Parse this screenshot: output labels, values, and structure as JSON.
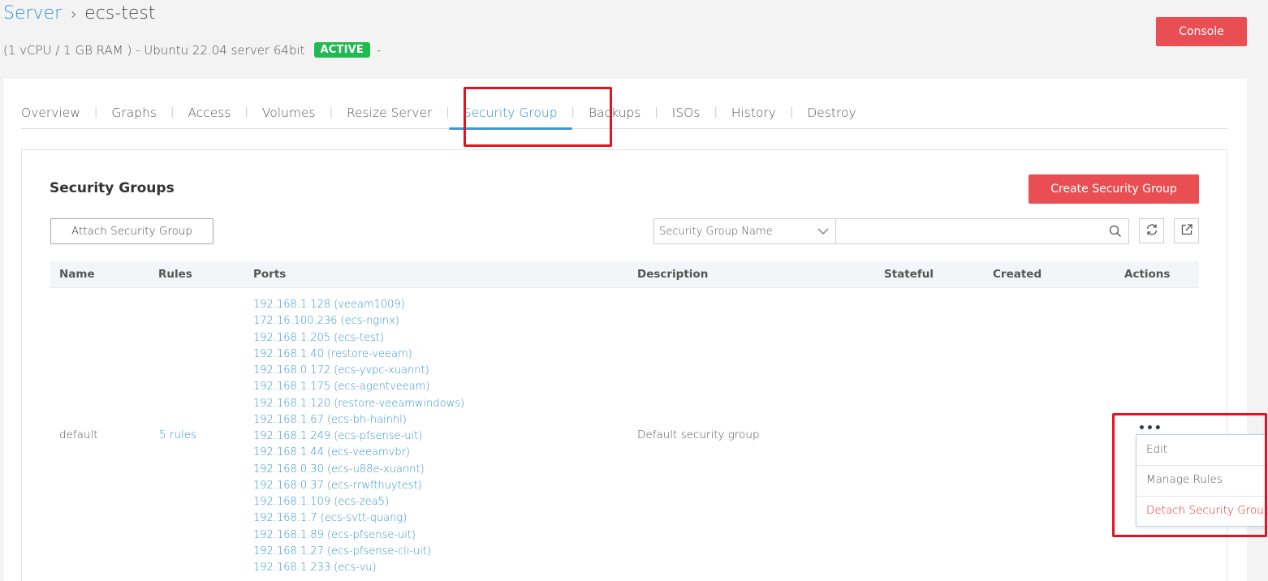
{
  "breadcrumb": {
    "root": "Server",
    "separator": "›",
    "current": "ecs-test"
  },
  "server_info": {
    "spec": "(1 vCPU / 1 GB RAM ) - Ubuntu 22.04 server 64bit",
    "status": "ACTIVE",
    "suffix": "-"
  },
  "console_label": "Console",
  "tabs": [
    {
      "label": "Overview"
    },
    {
      "label": "Graphs"
    },
    {
      "label": "Access"
    },
    {
      "label": "Volumes"
    },
    {
      "label": "Resize Server"
    },
    {
      "label": "Security Group"
    },
    {
      "label": "Backups"
    },
    {
      "label": "ISOs"
    },
    {
      "label": "History"
    },
    {
      "label": "Destroy"
    }
  ],
  "tab_separator": "|",
  "active_tab": "Security Group",
  "section": {
    "title": "Security Groups",
    "create_label": "Create Security Group",
    "attach_label": "Attach Security Group"
  },
  "filter": {
    "selected": "Security Group Name",
    "search_value": ""
  },
  "table": {
    "headers": {
      "name": "Name",
      "rules": "Rules",
      "ports": "Ports",
      "description": "Description",
      "stateful": "Stateful",
      "created": "Created",
      "actions": "Actions"
    },
    "row": {
      "name": "default",
      "rules": "5 rules",
      "description": "Default security group",
      "stateful": "",
      "created": "",
      "actions_icon": "•••",
      "ports": [
        "192.168.1.128 (veeam1009)",
        "172.16.100.236 (ecs-nginx)",
        "192.168.1.205 (ecs-test)",
        "192.168.1.40 (restore-veeam)",
        "192.168.0.172 (ecs-yvpc-xuannt)",
        "192.168.1.175 (ecs-agentveeam)",
        "192.168.1.120 (restore-veeamwindows)",
        "192.168.1.67 (ecs-bh-hainhl)",
        "192.168.1.249 (ecs-pfsense-uit)",
        "192.168.1.44 (ecs-veeamvbr)",
        "192.168.0.30 (ecs-u88e-xuannt)",
        "192.168.0.37 (ecs-rrwfthuytest)",
        "192.168.1.109 (ecs-zea5)",
        "192.168.1.7 (ecs-svtt-quang)",
        "192.168.1.89 (ecs-pfsense-uit)",
        "192.168.1.27 (ecs-pfsense-cli-uit)",
        "192.168.1.233 (ecs-vu)"
      ]
    }
  },
  "actions_menu": {
    "edit": "Edit",
    "manage_rules": "Manage Rules",
    "detach": "Detach Security Group"
  },
  "colors": {
    "accent": "#2f93d0",
    "primary_button": "#e94f52",
    "status_active": "#1fbb4f",
    "highlight": "#e8121d"
  }
}
